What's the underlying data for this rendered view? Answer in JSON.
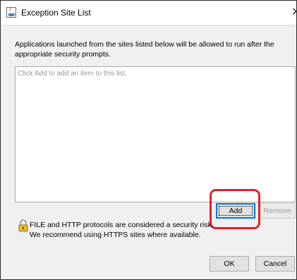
{
  "window": {
    "title": "Exception Site List"
  },
  "icons": {
    "app": "java-app-icon",
    "close": "close-icon",
    "warning": "padlock-warning-icon"
  },
  "description": "Applications launched from the sites listed below will be allowed to run after the appropriate security prompts.",
  "site_list": {
    "placeholder": "Click Add to add an item to this list.",
    "items": []
  },
  "buttons": {
    "add": "Add",
    "remove": "Remove",
    "ok": "OK",
    "cancel": "Cancel"
  },
  "warning": {
    "line1": "FILE and HTTP protocols are considered a security risk.",
    "line2": "We recommend using HTTPS sites where available."
  },
  "colors": {
    "highlight": "#e3212b",
    "focus_accent": "#0078d7"
  }
}
